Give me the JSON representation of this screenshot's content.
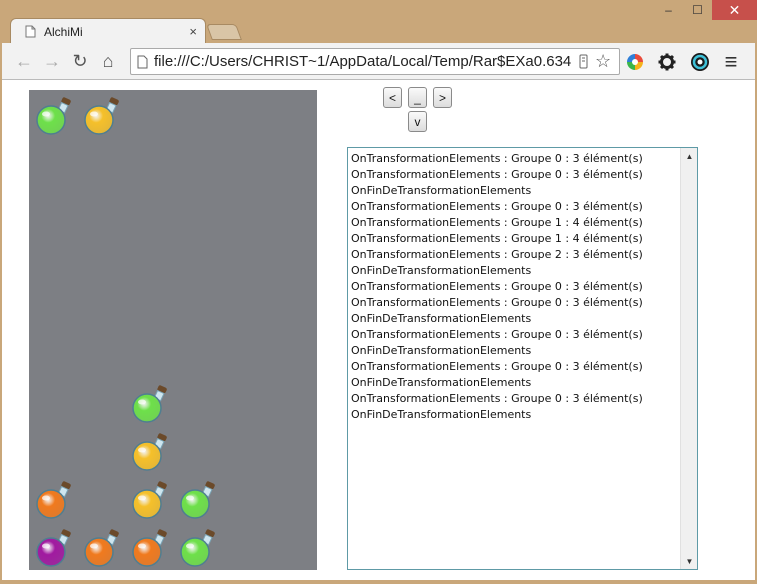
{
  "window": {
    "minimize_label": "‒",
    "maximize_label": "☐",
    "close_label": "✕"
  },
  "tab": {
    "title": "AlchiMi",
    "close_label": "×"
  },
  "toolbar": {
    "back_label": "←",
    "forward_label": "→",
    "reload_label": "↻",
    "home_label": "⌂",
    "url": "file:///C:/Users/CHRIST~1/AppData/Local/Temp/Rar$EXa0.634",
    "star_label": "☆",
    "menu_label": "≡"
  },
  "controls": {
    "left": "<",
    "drop": "_",
    "right": ">",
    "down": "v"
  },
  "board": {
    "potions": [
      {
        "col": 0,
        "row": 0,
        "color": "#6ee04a"
      },
      {
        "col": 1,
        "row": 0,
        "color": "#f5c02a"
      },
      {
        "col": 2,
        "row": 6,
        "color": "#6ee04a"
      },
      {
        "col": 2,
        "row": 7,
        "color": "#f5c02a"
      },
      {
        "col": 0,
        "row": 8,
        "color": "#f07a1e"
      },
      {
        "col": 2,
        "row": 8,
        "color": "#f5c02a"
      },
      {
        "col": 3,
        "row": 8,
        "color": "#6ee04a"
      },
      {
        "col": 0,
        "row": 9,
        "color": "#a11aa0"
      },
      {
        "col": 1,
        "row": 9,
        "color": "#f07a1e"
      },
      {
        "col": 2,
        "row": 9,
        "color": "#f07a1e"
      },
      {
        "col": 3,
        "row": 9,
        "color": "#6ee04a"
      }
    ]
  },
  "log": {
    "lines": [
      "OnTransformationElements : Groupe 0 : 3 élément(s)",
      "OnTransformationElements : Groupe 0 : 3 élément(s)",
      "OnFinDeTransformationElements",
      "OnTransformationElements : Groupe 0 : 3 élément(s)",
      "OnTransformationElements : Groupe 1 : 4 élément(s)",
      "OnTransformationElements : Groupe 1 : 4 élément(s)",
      "OnTransformationElements : Groupe 2 : 3 élément(s)",
      "OnFinDeTransformationElements",
      "OnTransformationElements : Groupe 0 : 3 élément(s)",
      "OnTransformationElements : Groupe 0 : 3 élément(s)",
      "OnFinDeTransformationElements",
      "OnTransformationElements : Groupe 0 : 3 élément(s)",
      "OnFinDeTransformationElements",
      "OnTransformationElements : Groupe 0 : 3 élément(s)",
      "OnFinDeTransformationElements",
      "OnTransformationElements : Groupe 0 : 3 élément(s)",
      "OnFinDeTransformationElements"
    ]
  }
}
